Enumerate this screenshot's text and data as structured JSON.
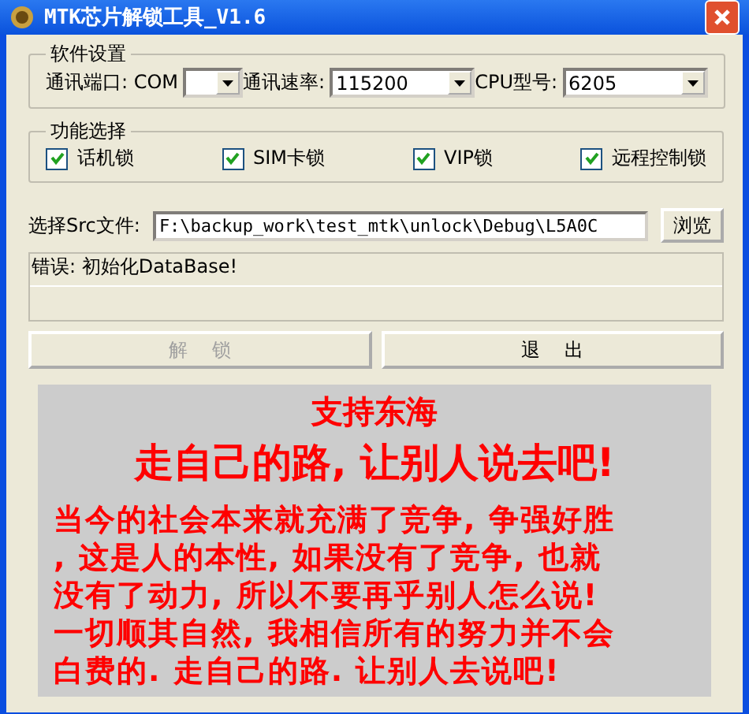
{
  "window": {
    "title": "MTK芯片解锁工具_V1.6"
  },
  "settings": {
    "title": "软件设置",
    "fields": [
      {
        "label": "通讯端口: COM",
        "kind": "narrow"
      },
      {
        "label": "通讯速率:",
        "value": "115200",
        "kind": "wide"
      },
      {
        "label": "CPU型号:",
        "value": "6205",
        "kind": "wide"
      }
    ]
  },
  "functions": {
    "title": "功能选择",
    "options": [
      {
        "label": "话机锁",
        "checked": true
      },
      {
        "label": "SIM卡锁",
        "checked": true
      },
      {
        "label": "VIP锁",
        "checked": true
      },
      {
        "label": "远程控制锁",
        "checked": true
      }
    ]
  },
  "file": {
    "label": "选择Src文件:",
    "value": "F:\\backup_work\\test_mtk\\unlock\\Debug\\L5A0C",
    "button": "浏览"
  },
  "log": {
    "lines": [
      "错误: 初始化DataBase!"
    ]
  },
  "buttons": [
    {
      "label": "解    锁",
      "disabled": true
    },
    {
      "label": "退    出",
      "disabled": false
    }
  ],
  "banner": {
    "heading": "支持东海",
    "slogan": "走自己的路, 让别人说去吧!",
    "lines": [
      "当今的社会本来就充满了竞争, 争强好胜",
      ", 这是人的本性, 如果没有了竞争, 也就",
      "没有了动力, 所以不要再乎别人怎么说!",
      "一切顺其自然, 我相信所有的努力并不会",
      "白费的. 走自己的路. 让别人去说吧!"
    ]
  }
}
